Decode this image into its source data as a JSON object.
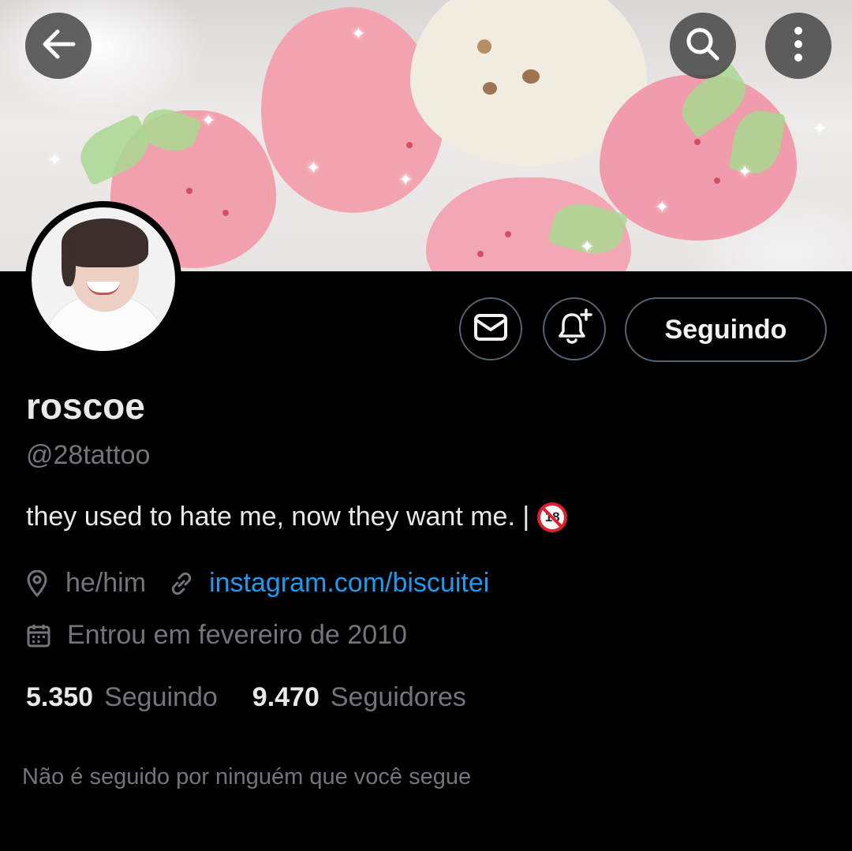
{
  "header": {
    "back_icon": "arrow-left-icon",
    "search_icon": "search-icon",
    "more_icon": "more-vertical-icon"
  },
  "profile": {
    "display_name": "roscoe",
    "handle": "@28tattoo",
    "bio": "they used to hate me, now they want me. |",
    "bio_emoji": "🔞",
    "location": "he/him",
    "website": "instagram.com/biscuitei",
    "joined": "Entrou em fevereiro de 2010"
  },
  "actions": {
    "message_icon": "envelope-icon",
    "notify_icon": "bell-plus-icon",
    "follow_label": "Seguindo"
  },
  "stats": {
    "following_count": "5.350",
    "following_label": "Seguindo",
    "followers_count": "9.470",
    "followers_label": "Seguidores"
  },
  "followed_by_note": "Não é seguido por ninguém que você segue",
  "colors": {
    "background": "#000000",
    "link": "#1d9bf0",
    "muted_text": "#71767b",
    "border": "#536471"
  }
}
